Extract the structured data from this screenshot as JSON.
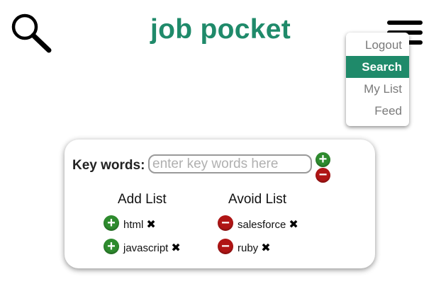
{
  "header": {
    "title": "job pocket",
    "search_icon": "search-icon",
    "menu_icon": "hamburger-icon"
  },
  "menu": {
    "items": [
      {
        "label": "Logout",
        "active": false
      },
      {
        "label": "Search",
        "active": true
      },
      {
        "label": "My List",
        "active": false
      },
      {
        "label": "Feed",
        "active": false
      }
    ]
  },
  "search_panel": {
    "keywords_label": "Key words:",
    "keywords_placeholder": "enter key words here",
    "keywords_value": "",
    "add_button_symbol": "+",
    "avoid_button_symbol": "−",
    "add_list": {
      "title": "Add List",
      "items": [
        {
          "label": "html",
          "remove_symbol": "✖"
        },
        {
          "label": "javascript",
          "remove_symbol": "✖"
        }
      ]
    },
    "avoid_list": {
      "title": "Avoid List",
      "items": [
        {
          "label": "salesforce",
          "remove_symbol": "✖"
        },
        {
          "label": "ruby",
          "remove_symbol": "✖"
        }
      ]
    }
  },
  "colors": {
    "brand": "#1f8a6a",
    "add": "#2e8b2e",
    "avoid": "#b01515"
  }
}
